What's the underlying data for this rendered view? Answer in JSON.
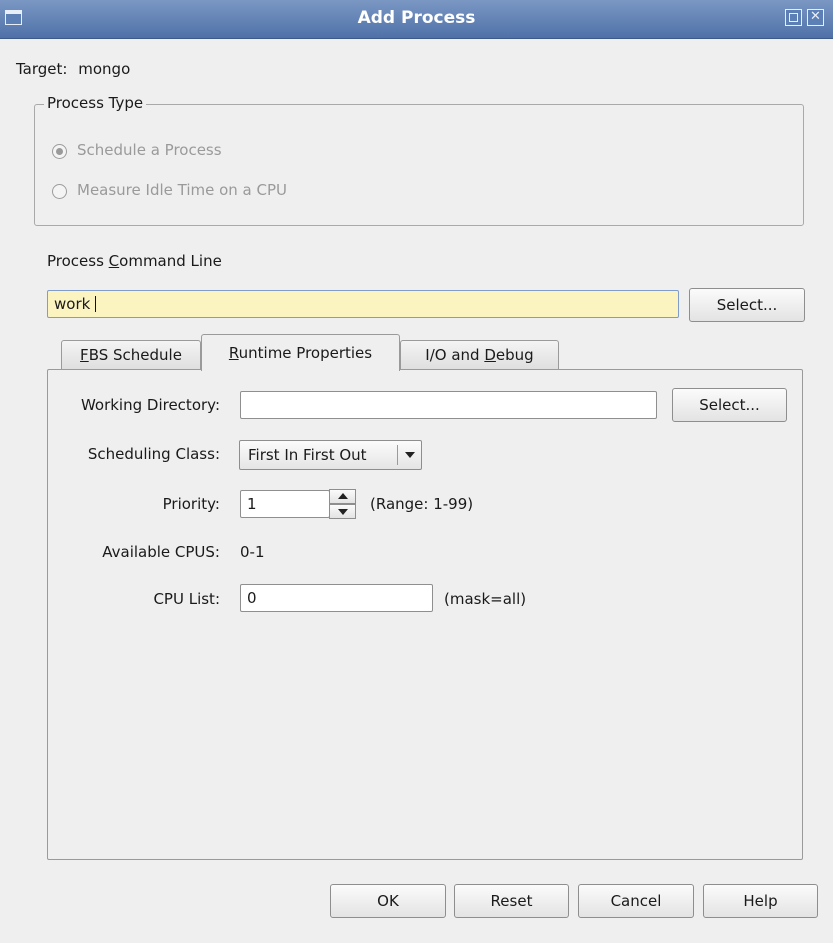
{
  "window": {
    "title": "Add Process"
  },
  "target": {
    "label": "Target:",
    "value": "mongo"
  },
  "process_type": {
    "title": "Process Type",
    "options": [
      {
        "label": "Schedule a Process",
        "selected": true
      },
      {
        "label": "Measure Idle Time on a CPU",
        "selected": false
      }
    ]
  },
  "command_line": {
    "label_pre": "Process ",
    "label_mnemonic": "C",
    "label_post": "ommand Line",
    "value": "work",
    "select_label": "Select..."
  },
  "tabs": [
    {
      "mnemonic": "F",
      "rest": "BS Schedule",
      "active": false
    },
    {
      "mnemonic": "R",
      "rest": "untime Properties",
      "active": true
    },
    {
      "pre": "I/O and ",
      "mnemonic": "D",
      "rest": "ebug",
      "active": false
    }
  ],
  "runtime": {
    "working_dir_label": "Working Directory:",
    "working_dir_value": "",
    "working_dir_select": "Select...",
    "sched_class_label": "Scheduling Class:",
    "sched_class_value": "First In First Out",
    "priority_label": "Priority:",
    "priority_value": "1",
    "priority_range": "(Range: 1-99)",
    "avail_cpus_label": "Available CPUS:",
    "avail_cpus_value": "0-1",
    "cpu_list_label": "CPU List:",
    "cpu_list_value": "0",
    "cpu_mask": "(mask=all)"
  },
  "buttons": {
    "ok": "OK",
    "reset": "Reset",
    "cancel": "Cancel",
    "help": "Help"
  },
  "colors": {
    "titlebar": "#4f71a8",
    "focused_input": "#fbf3c0"
  }
}
